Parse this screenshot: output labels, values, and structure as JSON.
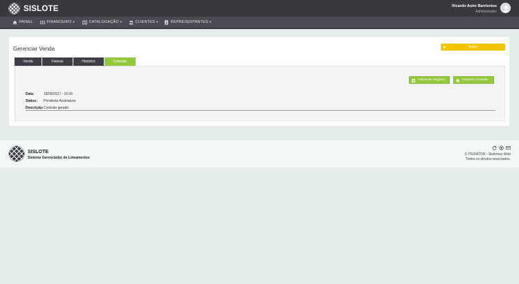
{
  "app": {
    "name": "SISLOTE"
  },
  "user": {
    "name": "Ricardo Auler Barrientos",
    "role": "Administrador"
  },
  "nav": {
    "items": [
      {
        "label": "PAINEL",
        "icon": "home-icon"
      },
      {
        "label": "FINANCEIRO",
        "icon": "money-icon",
        "caret": "▾"
      },
      {
        "label": "CATALOGAÇÃO",
        "icon": "map-icon",
        "caret": "▾"
      },
      {
        "label": "CLIENTES",
        "icon": "users-icon",
        "caret": "▾"
      },
      {
        "label": "REPRESENTANTES",
        "icon": "id-card-icon",
        "caret": "▾"
      }
    ]
  },
  "page": {
    "title": "Gerenciar Venda",
    "back_label": "Voltar",
    "tabs": [
      {
        "label": "Venda",
        "active": false
      },
      {
        "label": "Faturas",
        "active": false
      },
      {
        "label": "Histórico",
        "active": false
      },
      {
        "label": "Contrato",
        "active": true
      }
    ],
    "actions": {
      "add_record": "Adicionar Registro",
      "print_contract": "Imprimir Contrato"
    },
    "info": [
      {
        "label": "Data:",
        "value": "18/09/2017 - 16:36"
      },
      {
        "label": "Status:",
        "value": "Pendente Assinatura"
      },
      {
        "label": "Descrição:",
        "value": "Contrato gerado."
      }
    ]
  },
  "footer": {
    "name": "SISLOTE",
    "subtitle": "Sistema Gerenciador de Loteamentos",
    "copyright": "© ITERATOR - Sistemas Web",
    "rights": "Todos os direitos reservados.",
    "icons": [
      "refresh-icon",
      "github-icon",
      "mail-icon"
    ]
  },
  "colors": {
    "topbar": "#38383f",
    "accent_green": "#94c83d",
    "accent_yellow": "#f2c500",
    "tab_dark": "#3e3e46"
  }
}
